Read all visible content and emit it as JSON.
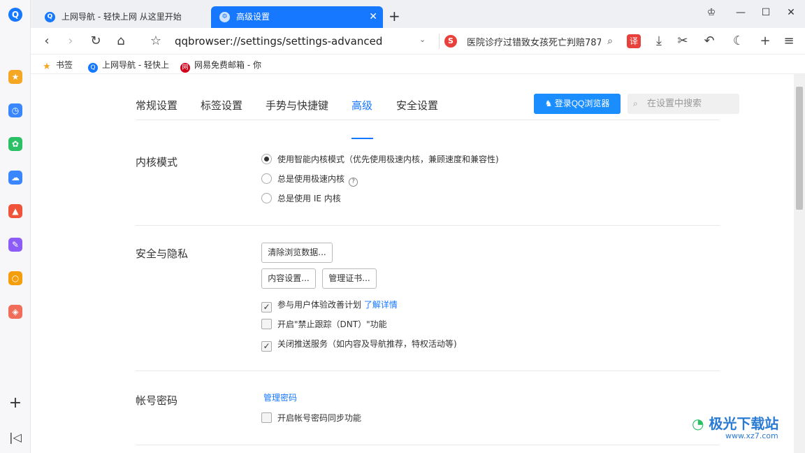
{
  "tabs": [
    {
      "label": "上网导航 - 轻快上网 从这里开始",
      "active": false
    },
    {
      "label": "高级设置",
      "active": true
    }
  ],
  "toolbar": {
    "url": "qqbrowser://settings/settings-advanced",
    "search_text": "医院诊疗过错致女孩死亡判赔787",
    "translate_label": "译"
  },
  "bookmarks": [
    {
      "label": "书签"
    },
    {
      "label": "上网导航 - 轻快上"
    },
    {
      "label": "网易免费邮箱 - 你"
    }
  ],
  "settings_tabs": [
    "常规设置",
    "标签设置",
    "手势与快捷键",
    "高级",
    "安全设置"
  ],
  "active_settings_tab": "高级",
  "login_button": "登录QQ浏览器",
  "settings_search_placeholder": "在设置中搜索",
  "kernel": {
    "title": "内核模式",
    "options": [
      {
        "label": "使用智能内核模式（优先使用极速内核，兼顾速度和兼容性)",
        "selected": true
      },
      {
        "label": "总是使用极速内核",
        "selected": false
      },
      {
        "label": "总是使用 IE 内核",
        "selected": false
      }
    ]
  },
  "privacy": {
    "title": "安全与隐私",
    "clear_button": "清除浏览数据...",
    "content_button": "内容设置...",
    "cert_button": "管理证书...",
    "checkboxes": [
      {
        "label": "参与用户体验改善计划",
        "checked": true,
        "link": "了解详情"
      },
      {
        "label": "开启\"禁止跟踪（DNT）\"功能",
        "checked": false
      },
      {
        "label": "关闭推送服务（如内容及导航推荐，特权活动等)",
        "checked": true
      }
    ]
  },
  "account": {
    "title": "帐号密码",
    "manage_link": "管理密码",
    "sync_label": "开启帐号密码同步功能",
    "sync_checked": false
  },
  "watermark": {
    "title": "极光下载站",
    "url": "www.xz7.com"
  },
  "colors": {
    "accent": "#1677ff",
    "tab_active": "#1677ff"
  }
}
